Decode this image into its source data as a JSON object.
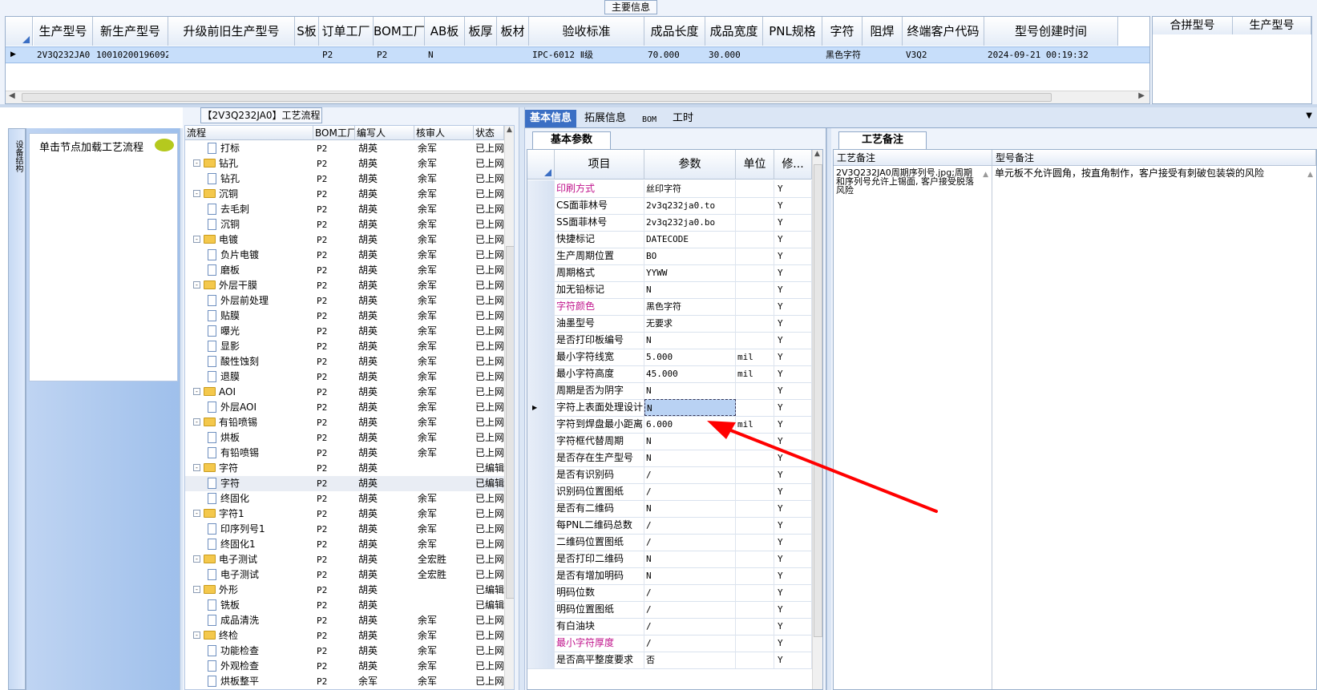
{
  "main_info": {
    "title": "主要信息",
    "columns": [
      "生产型号",
      "新生产型号",
      "升级前旧生产型号",
      "S板",
      "订单工厂",
      "BOM工厂",
      "AB板",
      "板厚",
      "板材",
      "验收标准",
      "成品长度",
      "成品宽度",
      "PNL规格",
      "字符",
      "阻焊",
      "终端客户代码",
      "型号创建时间"
    ],
    "row": [
      "2V3Q232JA0",
      "10010200196092",
      "",
      "",
      "P2",
      "P2",
      "N",
      "",
      "",
      "IPC-6012 Ⅱ级",
      "70.000",
      "30.000",
      "",
      "黑色字符",
      "",
      "V3Q2",
      "2024-09-21 00:19:32"
    ],
    "merge_columns": [
      "合拼型号",
      "生产型号"
    ]
  },
  "left_nav": {
    "vertical_tab": "设备结构",
    "hint": "单击节点加载工艺流程"
  },
  "process": {
    "title": "【2V3Q232JA0】工艺流程",
    "columns": [
      "流程",
      "BOM工厂",
      "编写人",
      "核审人",
      "状态"
    ],
    "rows": [
      {
        "level": 2,
        "type": "doc",
        "exp": "",
        "name": "打标",
        "bom": "P2",
        "writer": "胡英",
        "auditor": "余军",
        "status": "已上网"
      },
      {
        "level": 1,
        "type": "folder",
        "exp": "-",
        "name": "钻孔",
        "bom": "P2",
        "writer": "胡英",
        "auditor": "余军",
        "status": "已上网"
      },
      {
        "level": 2,
        "type": "doc",
        "exp": "",
        "name": "钻孔",
        "bom": "P2",
        "writer": "胡英",
        "auditor": "余军",
        "status": "已上网"
      },
      {
        "level": 1,
        "type": "folder",
        "exp": "-",
        "name": "沉铜",
        "bom": "P2",
        "writer": "胡英",
        "auditor": "余军",
        "status": "已上网"
      },
      {
        "level": 2,
        "type": "doc",
        "exp": "",
        "name": "去毛刺",
        "bom": "P2",
        "writer": "胡英",
        "auditor": "余军",
        "status": "已上网"
      },
      {
        "level": 2,
        "type": "doc",
        "exp": "",
        "name": "沉铜",
        "bom": "P2",
        "writer": "胡英",
        "auditor": "余军",
        "status": "已上网"
      },
      {
        "level": 1,
        "type": "folder",
        "exp": "-",
        "name": "电镀",
        "bom": "P2",
        "writer": "胡英",
        "auditor": "余军",
        "status": "已上网"
      },
      {
        "level": 2,
        "type": "doc",
        "exp": "",
        "name": "负片电镀",
        "bom": "P2",
        "writer": "胡英",
        "auditor": "余军",
        "status": "已上网"
      },
      {
        "level": 2,
        "type": "doc",
        "exp": "",
        "name": "磨板",
        "bom": "P2",
        "writer": "胡英",
        "auditor": "余军",
        "status": "已上网"
      },
      {
        "level": 1,
        "type": "folder",
        "exp": "-",
        "name": "外层干膜",
        "bom": "P2",
        "writer": "胡英",
        "auditor": "余军",
        "status": "已上网"
      },
      {
        "level": 2,
        "type": "doc",
        "exp": "",
        "name": "外层前处理",
        "bom": "P2",
        "writer": "胡英",
        "auditor": "余军",
        "status": "已上网"
      },
      {
        "level": 2,
        "type": "doc",
        "exp": "",
        "name": "贴膜",
        "bom": "P2",
        "writer": "胡英",
        "auditor": "余军",
        "status": "已上网"
      },
      {
        "level": 2,
        "type": "doc",
        "exp": "",
        "name": "曝光",
        "bom": "P2",
        "writer": "胡英",
        "auditor": "余军",
        "status": "已上网"
      },
      {
        "level": 2,
        "type": "doc",
        "exp": "",
        "name": "显影",
        "bom": "P2",
        "writer": "胡英",
        "auditor": "余军",
        "status": "已上网"
      },
      {
        "level": 2,
        "type": "doc",
        "exp": "",
        "name": "酸性蚀刻",
        "bom": "P2",
        "writer": "胡英",
        "auditor": "余军",
        "status": "已上网"
      },
      {
        "level": 2,
        "type": "doc",
        "exp": "",
        "name": "退膜",
        "bom": "P2",
        "writer": "胡英",
        "auditor": "余军",
        "status": "已上网"
      },
      {
        "level": 1,
        "type": "folder",
        "exp": "-",
        "name": "AOI",
        "bom": "P2",
        "writer": "胡英",
        "auditor": "余军",
        "status": "已上网"
      },
      {
        "level": 2,
        "type": "doc",
        "exp": "",
        "name": "外层AOI",
        "bom": "P2",
        "writer": "胡英",
        "auditor": "余军",
        "status": "已上网"
      },
      {
        "level": 1,
        "type": "folder",
        "exp": "-",
        "name": "有铅喷锡",
        "bom": "P2",
        "writer": "胡英",
        "auditor": "余军",
        "status": "已上网"
      },
      {
        "level": 2,
        "type": "doc",
        "exp": "",
        "name": "烘板",
        "bom": "P2",
        "writer": "胡英",
        "auditor": "余军",
        "status": "已上网"
      },
      {
        "level": 2,
        "type": "doc",
        "exp": "",
        "name": "有铅喷锡",
        "bom": "P2",
        "writer": "胡英",
        "auditor": "余军",
        "status": "已上网"
      },
      {
        "level": 1,
        "type": "folder",
        "exp": "-",
        "name": "字符",
        "bom": "P2",
        "writer": "胡英",
        "auditor": "",
        "status": "已编辑"
      },
      {
        "level": 2,
        "type": "doc",
        "exp": "",
        "name": "字符",
        "bom": "P2",
        "writer": "胡英",
        "auditor": "",
        "status": "已编辑",
        "sel": true
      },
      {
        "level": 2,
        "type": "doc",
        "exp": "",
        "name": "终固化",
        "bom": "P2",
        "writer": "胡英",
        "auditor": "余军",
        "status": "已上网"
      },
      {
        "level": 1,
        "type": "folder",
        "exp": "-",
        "name": "字符1",
        "bom": "P2",
        "writer": "胡英",
        "auditor": "余军",
        "status": "已上网"
      },
      {
        "level": 2,
        "type": "doc",
        "exp": "",
        "name": "印序列号1",
        "bom": "P2",
        "writer": "胡英",
        "auditor": "余军",
        "status": "已上网"
      },
      {
        "level": 2,
        "type": "doc",
        "exp": "",
        "name": "终固化1",
        "bom": "P2",
        "writer": "胡英",
        "auditor": "余军",
        "status": "已上网"
      },
      {
        "level": 1,
        "type": "folder",
        "exp": "-",
        "name": "电子测试",
        "bom": "P2",
        "writer": "胡英",
        "auditor": "全宏胜",
        "status": "已上网"
      },
      {
        "level": 2,
        "type": "doc",
        "exp": "",
        "name": "电子测试",
        "bom": "P2",
        "writer": "胡英",
        "auditor": "全宏胜",
        "status": "已上网"
      },
      {
        "level": 1,
        "type": "folder",
        "exp": "-",
        "name": "外形",
        "bom": "P2",
        "writer": "胡英",
        "auditor": "",
        "status": "已编辑"
      },
      {
        "level": 2,
        "type": "doc",
        "exp": "",
        "name": "铣板",
        "bom": "P2",
        "writer": "胡英",
        "auditor": "",
        "status": "已编辑"
      },
      {
        "level": 2,
        "type": "doc",
        "exp": "",
        "name": "成品清洗",
        "bom": "P2",
        "writer": "胡英",
        "auditor": "余军",
        "status": "已上网"
      },
      {
        "level": 1,
        "type": "folder",
        "exp": "-",
        "name": "终检",
        "bom": "P2",
        "writer": "胡英",
        "auditor": "余军",
        "status": "已上网"
      },
      {
        "level": 2,
        "type": "doc",
        "exp": "",
        "name": "功能检查",
        "bom": "P2",
        "writer": "胡英",
        "auditor": "余军",
        "status": "已上网"
      },
      {
        "level": 2,
        "type": "doc",
        "exp": "",
        "name": "外观检查",
        "bom": "P2",
        "writer": "胡英",
        "auditor": "余军",
        "status": "已上网"
      },
      {
        "level": 2,
        "type": "doc",
        "exp": "",
        "name": "烘板整平",
        "bom": "P2",
        "writer": "余军",
        "auditor": "余军",
        "status": "已上网"
      }
    ]
  },
  "tabs": [
    "基本信息",
    "拓展信息",
    "BOM",
    "工时"
  ],
  "basic": {
    "subtab": "基本参数",
    "columns": [
      "项目",
      "参数",
      "单位",
      "修..."
    ],
    "rows": [
      {
        "item": "印刷方式",
        "param": "丝印字符",
        "unit": "",
        "mod": "Y",
        "pink": true
      },
      {
        "item": "CS面菲林号",
        "param": "2v3q232ja0.to",
        "unit": "",
        "mod": "Y"
      },
      {
        "item": "SS面菲林号",
        "param": "2v3q232ja0.bo",
        "unit": "",
        "mod": "Y"
      },
      {
        "item": "快捷标记",
        "param": "DATECODE",
        "unit": "",
        "mod": "Y"
      },
      {
        "item": "生产周期位置",
        "param": "BO",
        "unit": "",
        "mod": "Y"
      },
      {
        "item": "周期格式",
        "param": "YYWW",
        "unit": "",
        "mod": "Y"
      },
      {
        "item": "加无铅标记",
        "param": "N",
        "unit": "",
        "mod": "Y"
      },
      {
        "item": "字符颜色",
        "param": "黑色字符",
        "unit": "",
        "mod": "Y",
        "pink": true
      },
      {
        "item": "油墨型号",
        "param": "无要求",
        "unit": "",
        "mod": "Y"
      },
      {
        "item": "是否打印板编号",
        "param": "N",
        "unit": "",
        "mod": "Y"
      },
      {
        "item": "最小字符线宽",
        "param": "5.000",
        "unit": "mil",
        "mod": "Y"
      },
      {
        "item": "最小字符高度",
        "param": "45.000",
        "unit": "mil",
        "mod": "Y"
      },
      {
        "item": "周期是否为阴字",
        "param": "N",
        "unit": "",
        "mod": "Y"
      },
      {
        "item": "字符上表面处理设计",
        "param": "N",
        "unit": "",
        "mod": "Y",
        "sel": true
      },
      {
        "item": "字符到焊盘最小距离",
        "param": "6.000",
        "unit": "mil",
        "mod": "Y"
      },
      {
        "item": "字符框代替周期",
        "param": "N",
        "unit": "",
        "mod": "Y"
      },
      {
        "item": "是否存在生产型号",
        "param": "N",
        "unit": "",
        "mod": "Y"
      },
      {
        "item": "是否有识别码",
        "param": "/",
        "unit": "",
        "mod": "Y"
      },
      {
        "item": "识别码位置图纸",
        "param": "/",
        "unit": "",
        "mod": "Y"
      },
      {
        "item": "是否有二维码",
        "param": "N",
        "unit": "",
        "mod": "Y"
      },
      {
        "item": "每PNL二维码总数",
        "param": "/",
        "unit": "",
        "mod": "Y"
      },
      {
        "item": "二维码位置图纸",
        "param": "/",
        "unit": "",
        "mod": "Y"
      },
      {
        "item": "是否打印二维码",
        "param": "N",
        "unit": "",
        "mod": "Y"
      },
      {
        "item": "是否有增加明码",
        "param": "N",
        "unit": "",
        "mod": "Y"
      },
      {
        "item": "明码位数",
        "param": "/",
        "unit": "",
        "mod": "Y"
      },
      {
        "item": "明码位置图纸",
        "param": "/",
        "unit": "",
        "mod": "Y"
      },
      {
        "item": "有白油块",
        "param": "/",
        "unit": "",
        "mod": "Y"
      },
      {
        "item": "最小字符厚度",
        "param": "/",
        "unit": "",
        "mod": "Y",
        "pink": true
      },
      {
        "item": "是否高平整度要求",
        "param": "否",
        "unit": "",
        "mod": "Y"
      }
    ]
  },
  "remarks": {
    "subtab": "工艺备注",
    "col1": "工艺备注",
    "col2": "型号备注",
    "text1": "2V3Q232JA0周期序列号.jpg;周期和序列号允许上锡面, 客户接受脱落风险",
    "text2": "单元板不允许圆角，按直角制作，客户接受有刺破包装袋的风险"
  },
  "colors": {
    "accent": "#3b6fc4",
    "selection": "#c7defa",
    "arrow": "#ff0000",
    "pink_text": "#c0148c"
  }
}
